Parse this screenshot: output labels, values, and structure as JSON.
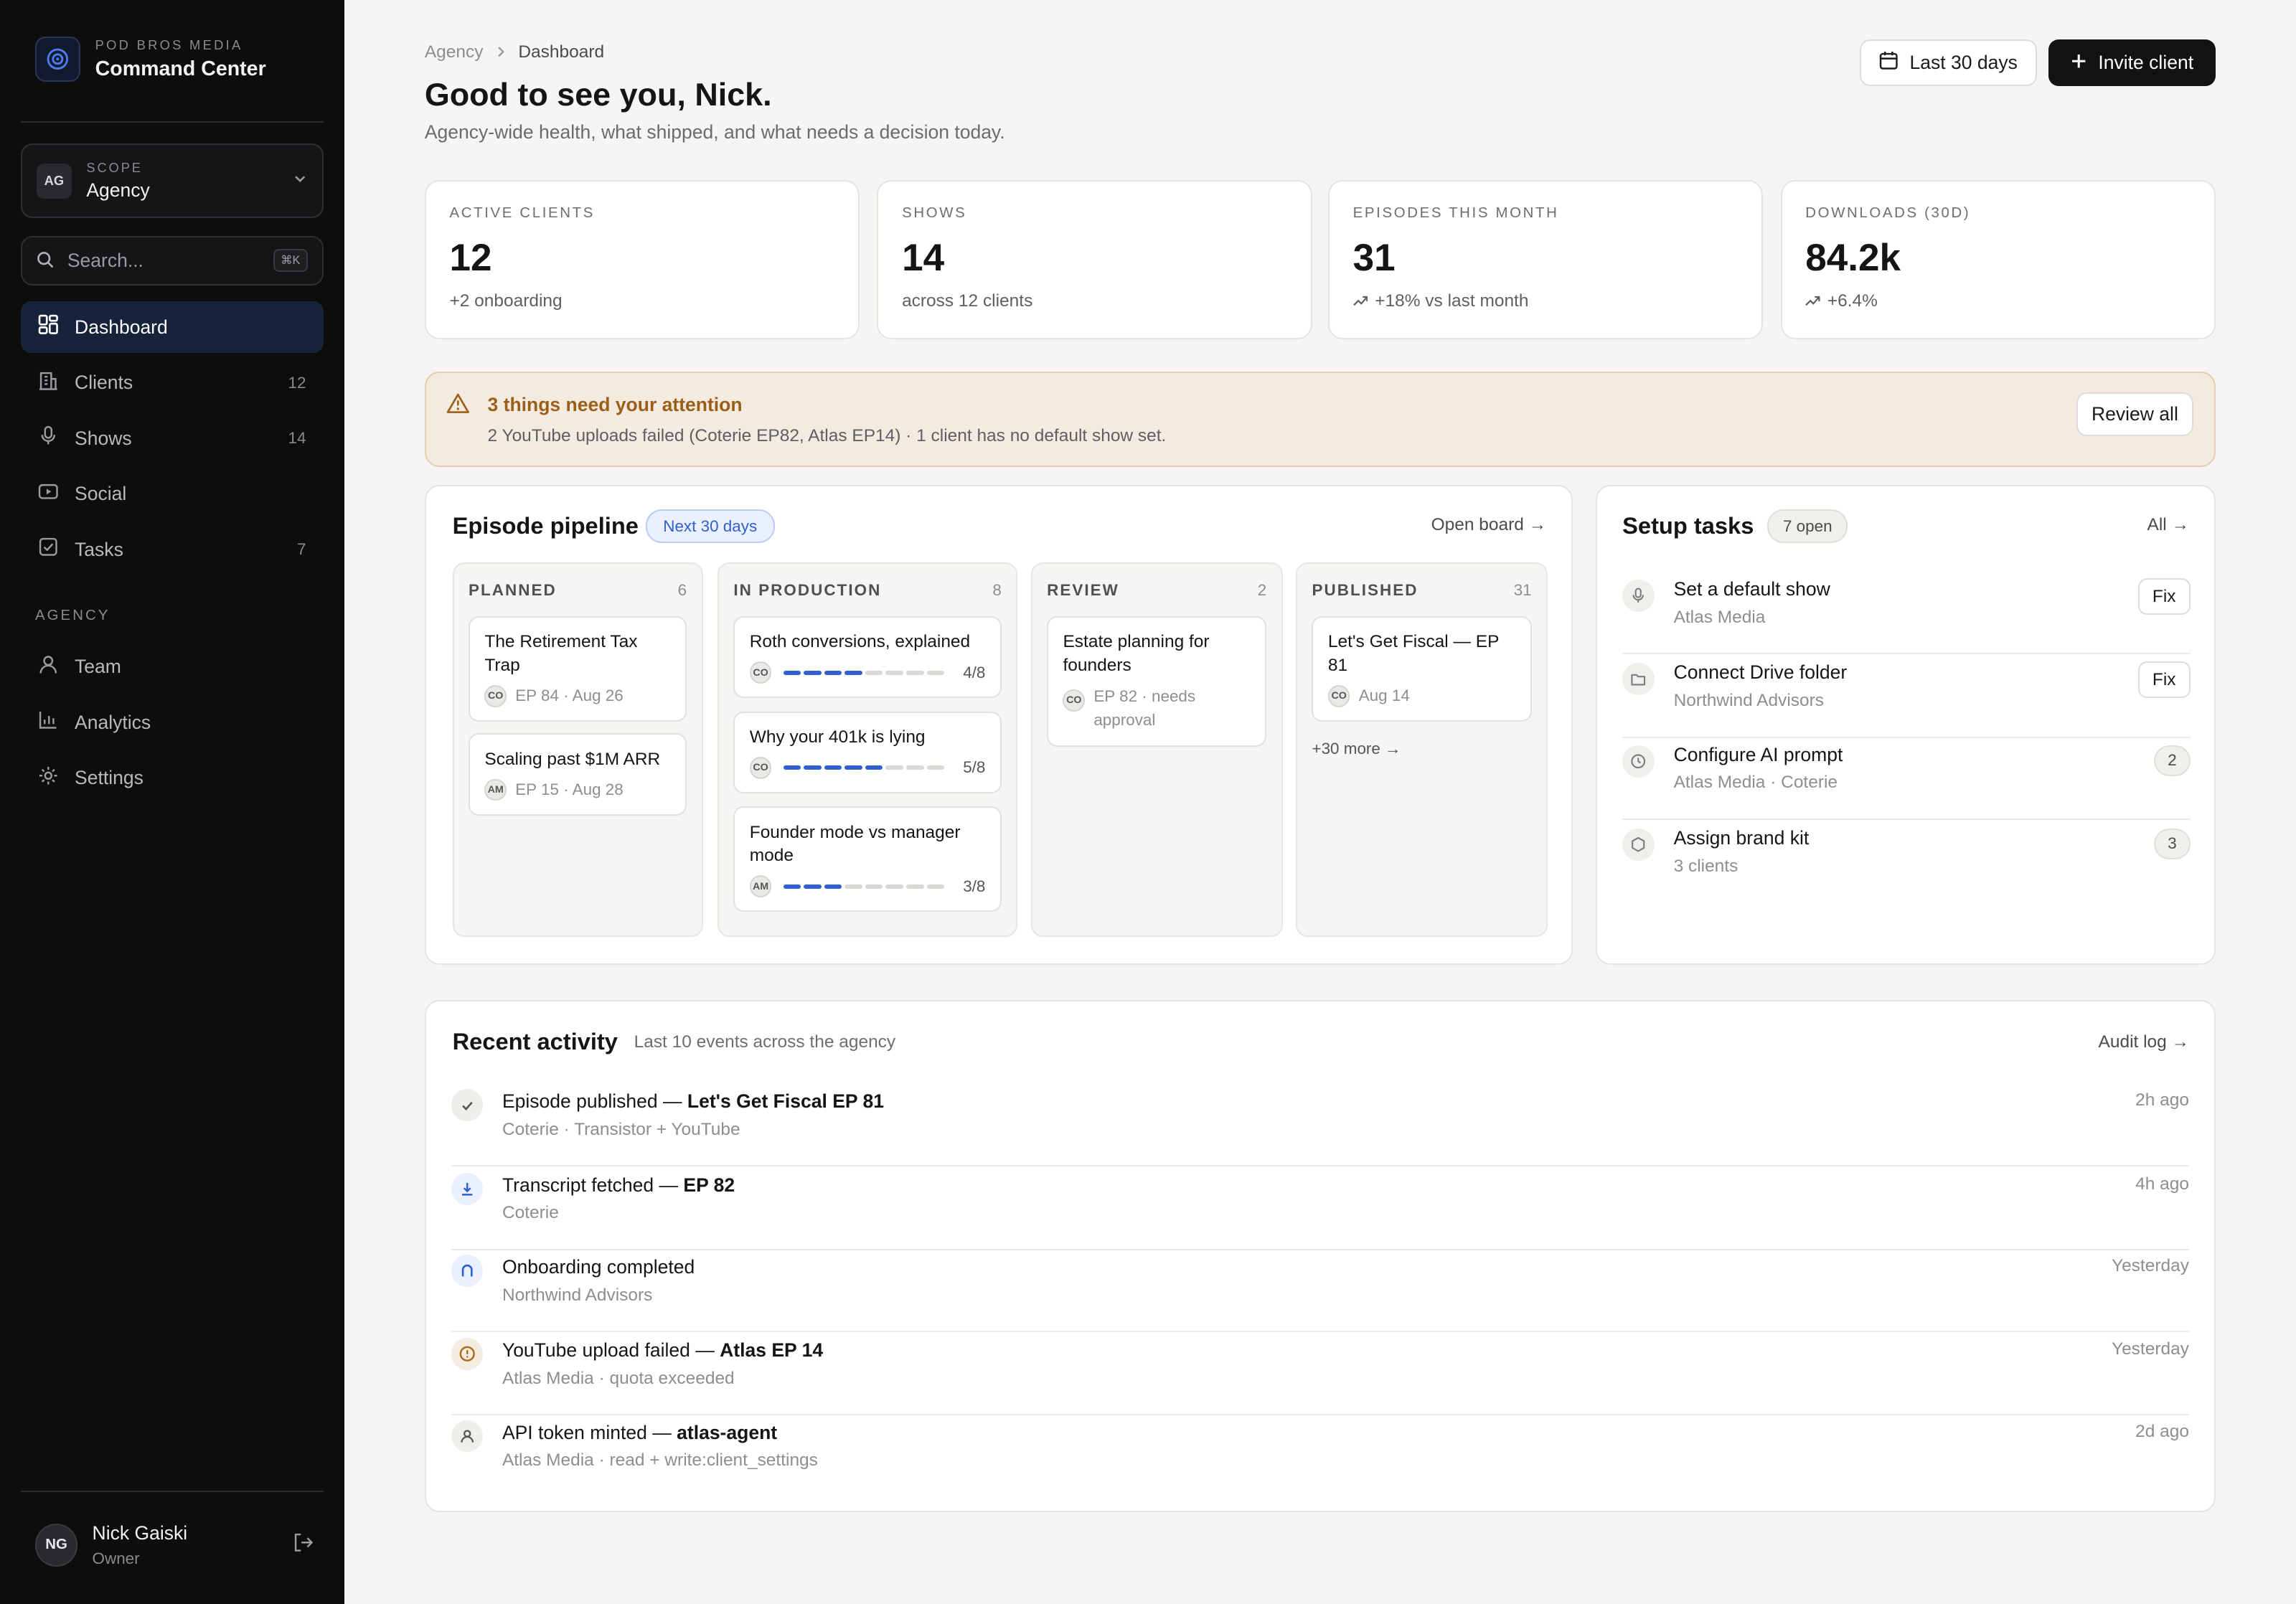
{
  "sidebar": {
    "brand_eyebrow": "POD BROS MEDIA",
    "brand_name": "Command Center",
    "scope": {
      "label": "SCOPE",
      "value": "Agency",
      "avatar": "AG"
    },
    "search": {
      "placeholder": "Search...",
      "shortcut": "⌘K"
    },
    "nav": [
      {
        "label": "Dashboard",
        "icon": "grid-icon",
        "count": ""
      },
      {
        "label": "Clients",
        "icon": "building-icon",
        "count": "12"
      },
      {
        "label": "Shows",
        "icon": "mic-icon",
        "count": "14"
      },
      {
        "label": "Social",
        "icon": "play-icon",
        "count": ""
      },
      {
        "label": "Tasks",
        "icon": "checkbox-icon",
        "count": "7"
      }
    ],
    "section_label": "AGENCY",
    "agency_nav": [
      {
        "label": "Team",
        "icon": "user-icon"
      },
      {
        "label": "Analytics",
        "icon": "bar-chart-icon"
      },
      {
        "label": "Settings",
        "icon": "gear-icon"
      }
    ],
    "user": {
      "initials": "NG",
      "name": "Nick Gaiski",
      "role": "Owner"
    }
  },
  "header": {
    "breadcrumb": [
      "Agency",
      "Dashboard"
    ],
    "greeting": "Good to see you, Nick.",
    "subtitle": "Agency-wide health, what shipped, and what needs a decision today.",
    "range_button": "Last 30 days",
    "invite_button": "Invite client"
  },
  "stats": [
    {
      "label": "ACTIVE CLIENTS",
      "value": "12",
      "sub": "+2 onboarding"
    },
    {
      "label": "SHOWS",
      "value": "14",
      "sub": "across 12 clients"
    },
    {
      "label": "EPISODES THIS MONTH",
      "value": "31",
      "sub": "+18% vs last month"
    },
    {
      "label": "DOWNLOADS (30D)",
      "value": "84.2k",
      "sub": "+6.4%"
    }
  ],
  "alert": {
    "title": "3 things need your attention",
    "body": "2 YouTube uploads failed (Coterie EP82, Atlas EP14) · 1 client has no default show set.",
    "button": "Review all"
  },
  "pipeline": {
    "title": "Episode pipeline",
    "pill": "Next 30 days",
    "link": "Open board →",
    "columns": [
      {
        "name": "PLANNED",
        "count": "6",
        "cards": [
          {
            "title": "The Retirement Tax Trap",
            "avatar": "CO",
            "meta": "EP 84 · Aug 26"
          },
          {
            "title": "Scaling past $1M ARR",
            "avatar": "AM",
            "meta": "EP 15 · Aug 28"
          }
        ]
      },
      {
        "name": "IN PRODUCTION",
        "count": "8",
        "cards": [
          {
            "title": "Roth conversions, explained",
            "avatar": "CO",
            "progress": "4/8",
            "done": 4
          },
          {
            "title": "Why your 401k is lying",
            "avatar": "CO",
            "progress": "5/8",
            "done": 5
          },
          {
            "title": "Founder mode vs manager mode",
            "avatar": "AM",
            "progress": "3/8",
            "done": 3
          }
        ]
      },
      {
        "name": "REVIEW",
        "count": "2",
        "cards": [
          {
            "title": "Estate planning for founders",
            "avatar": "CO",
            "meta": "EP 82 · needs approval"
          }
        ]
      },
      {
        "name": "PUBLISHED",
        "count": "31",
        "cards": [
          {
            "title": "Let's Get Fiscal — EP 81",
            "avatar": "CO",
            "meta": "Aug 14"
          }
        ],
        "more": "+30 more →"
      }
    ]
  },
  "setup": {
    "title": "Setup tasks",
    "pill": "7 open",
    "link": "All →",
    "tasks": [
      {
        "name": "Set a default show",
        "sub": "Atlas Media",
        "action": "Fix",
        "icon": "mic-icon"
      },
      {
        "name": "Connect Drive folder",
        "sub": "Northwind Advisors",
        "action": "Fix",
        "icon": "folder-icon"
      },
      {
        "name": "Configure AI prompt",
        "sub": "Atlas Media · Coterie",
        "badge": "2",
        "icon": "clock-icon"
      },
      {
        "name": "Assign brand kit",
        "sub": "3 clients",
        "badge": "3",
        "icon": "hexagon-icon"
      }
    ]
  },
  "activity": {
    "title": "Recent activity",
    "subtitle": "Last 10 events across the agency",
    "link": "Audit log →",
    "items": [
      {
        "prefix": "Episode published — ",
        "strong": "Let's Get Fiscal EP 81",
        "sub": "Coterie · Transistor + YouTube",
        "time": "2h ago",
        "icon": "check-icon"
      },
      {
        "prefix": "Transcript fetched — ",
        "strong": "EP 82",
        "sub": "Coterie",
        "time": "4h ago",
        "icon": "download-icon"
      },
      {
        "prefix": "Onboarding completed",
        "strong": "",
        "sub": "Northwind Advisors",
        "time": "Yesterday",
        "icon": "magnet-icon"
      },
      {
        "prefix": "YouTube upload failed — ",
        "strong": "Atlas EP 14",
        "sub": "Atlas Media · quota exceeded",
        "time": "Yesterday",
        "icon": "alert-circle-icon"
      },
      {
        "prefix": "API token minted — ",
        "strong": "atlas-agent",
        "sub": "Atlas Media · read + write:client_settings",
        "time": "2d ago",
        "icon": "person-icon"
      }
    ]
  },
  "colors": {
    "accent": "#2f5fd0",
    "sidebar_bg": "#0d0d0e",
    "active_nav": "#17223b",
    "alert_bg": "#f3ebe0",
    "alert_text": "#9b5f1a"
  }
}
